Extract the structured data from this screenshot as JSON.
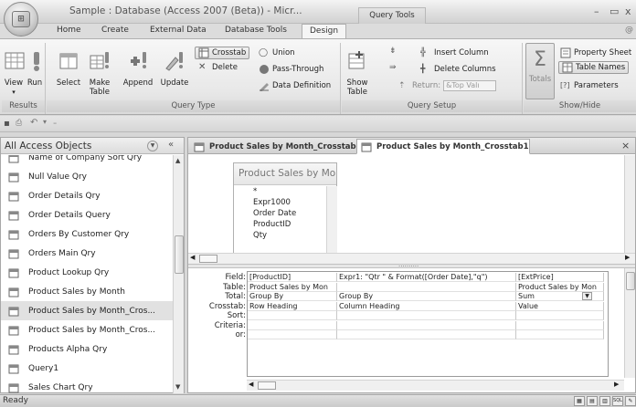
{
  "window": {
    "title": "Sample : Database (Access 2007 (Beta)) - Micr...",
    "context_tab_group": "Query Tools",
    "minimize_glyph": "–",
    "maximize_glyph": "▭",
    "close_glyph": "x"
  },
  "ribbon_tabs": [
    "Home",
    "Create",
    "External Data",
    "Database Tools",
    "Design"
  ],
  "ribbon": {
    "results": {
      "label": "Results",
      "view": "View",
      "run": "Run"
    },
    "query_type": {
      "label": "Query Type",
      "select": "Select",
      "make_table": "Make Table",
      "append": "Append",
      "update": "Update",
      "crosstab": "Crosstab",
      "delete": "Delete",
      "union": "Union",
      "pass_through": "Pass-Through",
      "data_definition": "Data Definition"
    },
    "query_setup": {
      "label": "Query Setup",
      "show_table": "Show Table",
      "insert_column": "Insert Column",
      "delete_columns": "Delete Columns",
      "return_label": "Return:",
      "return_value": "&Top Valı"
    },
    "show_hide": {
      "label": "Show/Hide",
      "totals": "Totals",
      "property_sheet": "Property Sheet",
      "table_names": "Table Names",
      "parameters": "Parameters"
    }
  },
  "nav_pane": {
    "title": "All Access Objects",
    "collapse_glyph": "«",
    "items": [
      "Name of Company Sort Qry",
      "Null Value Qry",
      "Order Details Qry",
      "Order Details Query",
      "Orders By Customer Qry",
      "Orders Main Qry",
      "Product Lookup Qry",
      "Product Sales by Month",
      "Product Sales by Month_Cros...",
      "Product Sales by Month_Cros...",
      "Products Alpha Qry",
      "Query1",
      "Sales Chart Qry"
    ],
    "selected_index": 8
  },
  "doc_tabs": [
    "Product Sales by Month_Crosstab",
    "Product Sales by Month_Crosstab1"
  ],
  "doc_close_glyph": "×",
  "field_list": {
    "title": "Product Sales by Mo...",
    "fields": [
      "*",
      "Expr1000",
      "Order Date",
      "ProductID",
      "Qty"
    ]
  },
  "splitter_text": "..........",
  "grid": {
    "row_labels": [
      "Field:",
      "Table:",
      "Total:",
      "Crosstab:",
      "Sort:",
      "Criteria:",
      "or:"
    ],
    "columns": [
      [
        "[ProductID]",
        "Product Sales by Mon",
        "Group By",
        "Row Heading",
        "",
        "",
        ""
      ],
      [
        "Expr1: \"Qtr \" & Format([Order Date],\"q\")",
        "",
        "Group By",
        "Column Heading",
        "",
        "",
        ""
      ],
      [
        "[ExtPrice]",
        "Product Sales by Mon",
        "Sum",
        "Value",
        "",
        "",
        ""
      ]
    ]
  },
  "status": {
    "text": "Ready",
    "sql_label": "SQL"
  },
  "colors": {
    "selected_bg": "#e1e1e1",
    "chrome": "#d7d7d7"
  }
}
